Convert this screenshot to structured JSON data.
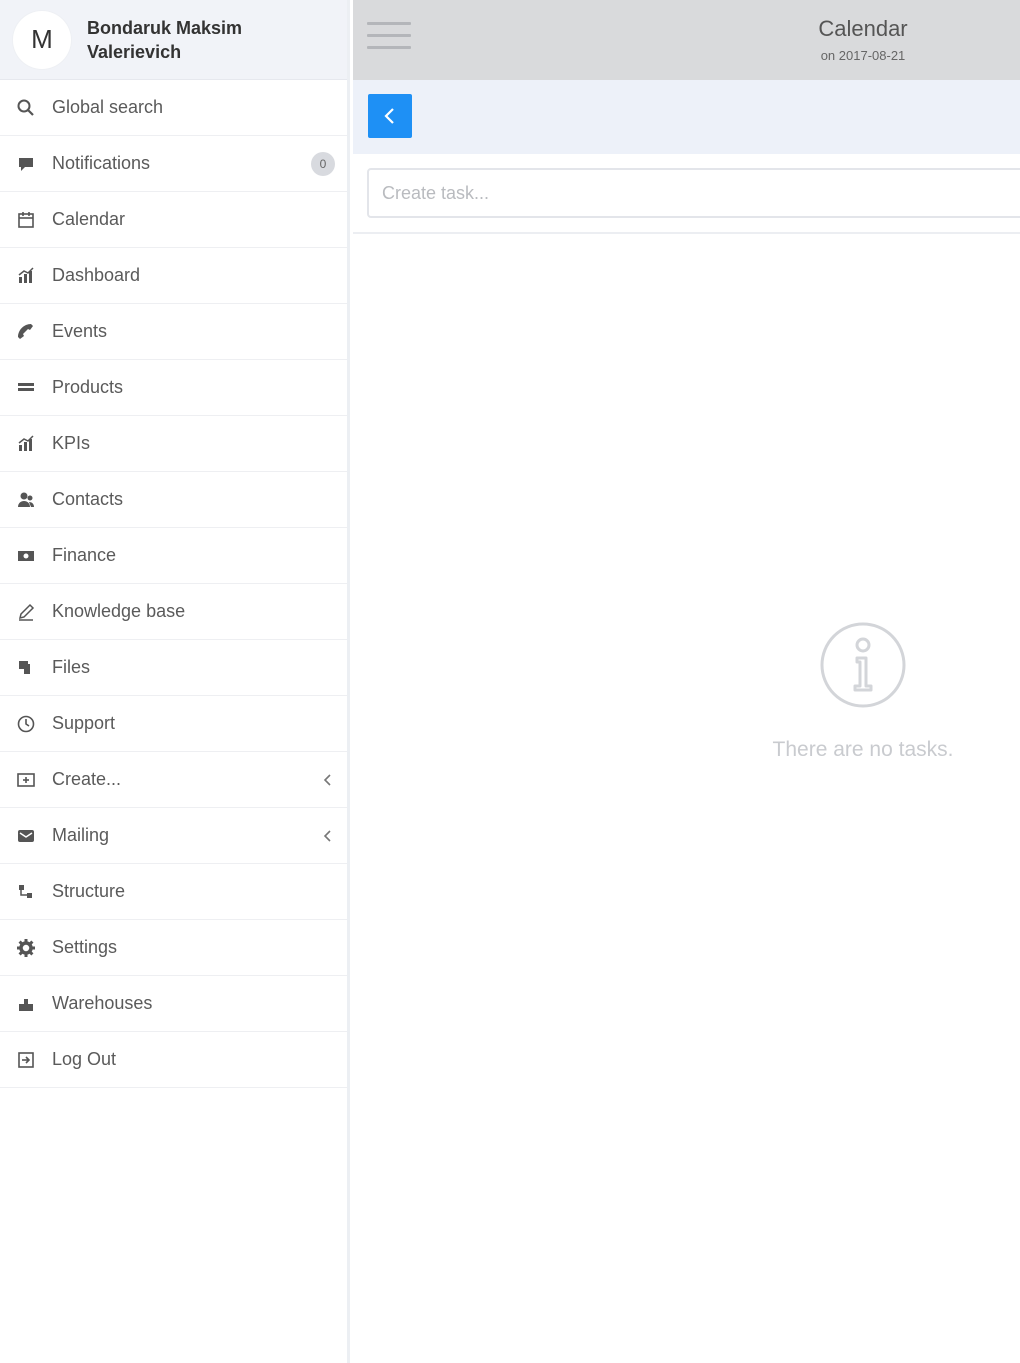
{
  "user": {
    "initial": "M",
    "name": "Bondaruk Maksim Valerievich"
  },
  "sidebar": {
    "items": [
      {
        "label": "Global search",
        "icon": "search-icon"
      },
      {
        "label": "Notifications",
        "icon": "chat-bubble-icon",
        "badge": "0"
      },
      {
        "label": "Calendar",
        "icon": "calendar-icon"
      },
      {
        "label": "Dashboard",
        "icon": "chart-icon"
      },
      {
        "label": "Events",
        "icon": "phone-icon"
      },
      {
        "label": "Products",
        "icon": "list-icon"
      },
      {
        "label": "KPIs",
        "icon": "chart-icon"
      },
      {
        "label": "Contacts",
        "icon": "users-icon"
      },
      {
        "label": "Finance",
        "icon": "money-icon"
      },
      {
        "label": "Knowledge base",
        "icon": "pencil-icon"
      },
      {
        "label": "Files",
        "icon": "files-icon"
      },
      {
        "label": "Support",
        "icon": "clock-icon"
      },
      {
        "label": "Create...",
        "icon": "create-icon",
        "chevron": "chevron-left-icon"
      },
      {
        "label": "Mailing",
        "icon": "mail-icon",
        "chevron": "chevron-left-icon"
      },
      {
        "label": "Structure",
        "icon": "structure-icon"
      },
      {
        "label": "Settings",
        "icon": "gear-icon"
      },
      {
        "label": "Warehouses",
        "icon": "warehouse-icon"
      },
      {
        "label": "Log Out",
        "icon": "logout-icon"
      }
    ]
  },
  "header": {
    "title": "Calendar",
    "subtitle": "on 2017-08-21"
  },
  "task": {
    "placeholder": "Create task..."
  },
  "empty": {
    "icon": "info-icon",
    "text": "There are no tasks."
  },
  "colors": {
    "accent": "#1e90f5",
    "topbar": "#d9dadc",
    "subbar": "#edf1f9"
  }
}
